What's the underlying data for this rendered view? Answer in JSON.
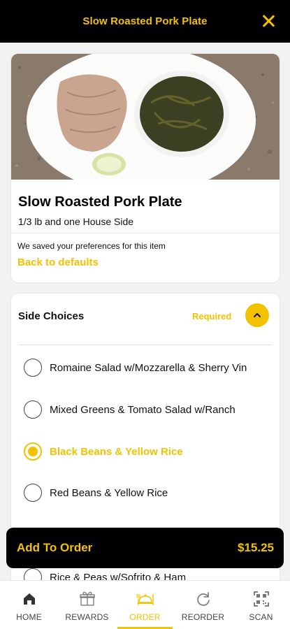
{
  "header": {
    "title": "Slow Roasted Pork Plate",
    "close_icon": "close-icon"
  },
  "item": {
    "name": "Slow Roasted Pork Plate",
    "description": "1/3 lb and one House Side",
    "pref_note": "We saved your preferences for this item",
    "back_link": "Back to defaults"
  },
  "side_choices": {
    "heading": "Side Choices",
    "required_label": "Required",
    "options": [
      {
        "label": "Romaine Salad w/Mozzarella & Sherry Vin",
        "selected": false
      },
      {
        "label": "Mixed Greens & Tomato Salad w/Ranch",
        "selected": false
      },
      {
        "label": "Black Beans & Yellow Rice",
        "selected": true
      },
      {
        "label": "Red Beans & Yellow Rice",
        "selected": false
      },
      {
        "label": "Rice & Peas w/Sofrito & Ham",
        "selected": false
      }
    ]
  },
  "add_to_order": {
    "label": "Add To Order",
    "price": "$15.25"
  },
  "tabs": [
    {
      "label": "HOME",
      "icon": "home-icon",
      "active": false
    },
    {
      "label": "REWARDS",
      "icon": "gift-icon",
      "active": false
    },
    {
      "label": "ORDER",
      "icon": "dish-icon",
      "active": true
    },
    {
      "label": "REORDER",
      "icon": "refresh-icon",
      "active": false
    },
    {
      "label": "SCAN",
      "icon": "qr-scan-icon",
      "active": false
    }
  ],
  "colors": {
    "accent": "#f2c200",
    "header_bg": "#000000"
  }
}
